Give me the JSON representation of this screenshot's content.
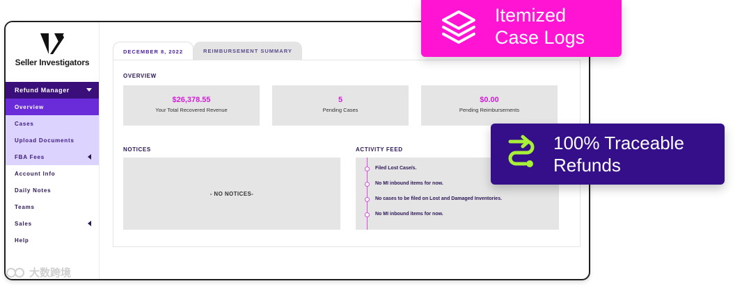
{
  "brand": {
    "name": "Seller Investigators"
  },
  "sidebar": {
    "menu_head": "Refund Manager",
    "items": [
      {
        "label": "Overview"
      },
      {
        "label": "Cases"
      },
      {
        "label": "Upload Documents"
      },
      {
        "label": "FBA Fees"
      },
      {
        "label": "Account Info"
      },
      {
        "label": "Daily Notes"
      },
      {
        "label": "Teams"
      },
      {
        "label": "Sales"
      },
      {
        "label": "Help"
      }
    ]
  },
  "tabs": [
    {
      "label": "DECEMBER 8, 2022"
    },
    {
      "label": "REIMBURSEMENT SUMMARY"
    }
  ],
  "overview": {
    "title": "OVERVIEW",
    "cards": [
      {
        "value": "$26,378.55",
        "label": "Your Total Recovered Revenue"
      },
      {
        "value": "5",
        "label": "Pending Cases"
      },
      {
        "value": "$0.00",
        "label": "Pending Reimbursements"
      }
    ]
  },
  "notices": {
    "title": "NOTICES",
    "empty": "- NO NOTICES-"
  },
  "activity": {
    "title": "ACTIVITY FEED",
    "items": [
      "Filed Lost Case/s.",
      "No MI inbound items for now.",
      "No cases to be filed on Lost and Damaged Inventories.",
      "No MI inbound items for now."
    ]
  },
  "callouts": {
    "a": {
      "line1": "Itemized",
      "line2": "Case Logs"
    },
    "b": {
      "line1": "100% Traceable",
      "line2": "Refunds"
    }
  },
  "watermark": "大数跨境",
  "colors": {
    "magenta": "#ff14d3",
    "purple": "#350f8a",
    "accent_value": "#d01dd8",
    "nav_active": "#6a2bd9"
  }
}
